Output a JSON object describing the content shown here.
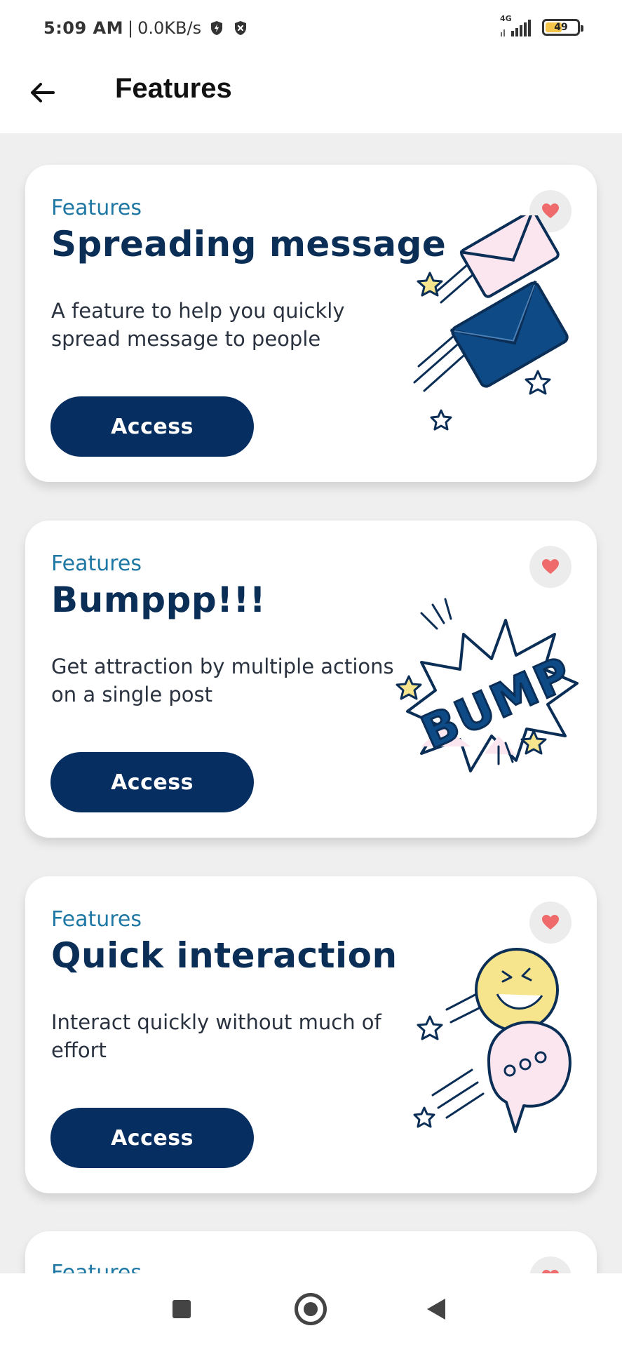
{
  "status_bar": {
    "time": "5:09 AM",
    "separator": "|",
    "network_speed": "0.0KB/s",
    "network_type": "4G",
    "battery_level": "49"
  },
  "app_bar": {
    "title": "Features"
  },
  "cards": [
    {
      "kicker": "Features",
      "title": "Spreading message",
      "description": "A feature to help you quickly spread message to people",
      "button_label": "Access",
      "favorite_icon": "heart-icon",
      "illustration": "flying-envelopes-illustration"
    },
    {
      "kicker": "Features",
      "title": "Bumppp!!!",
      "description": "Get attraction by multiple actions on a single post",
      "button_label": "Access",
      "favorite_icon": "heart-icon",
      "illustration": "bump-burst-illustration",
      "illustration_text": "BUMP"
    },
    {
      "kicker": "Features",
      "title": "Quick interaction",
      "description": "Interact quickly without much of effort",
      "button_label": "Access",
      "favorite_icon": "heart-icon",
      "illustration": "chat-bubbles-illustration"
    },
    {
      "kicker": "Features"
    }
  ],
  "colors": {
    "background": "#efefef",
    "primary": "#072e61",
    "accent": "#1f78a4",
    "heart": "#ef6b6b",
    "illustration_yellow": "#f7e58d",
    "illustration_pink": "#fbe6ef"
  }
}
